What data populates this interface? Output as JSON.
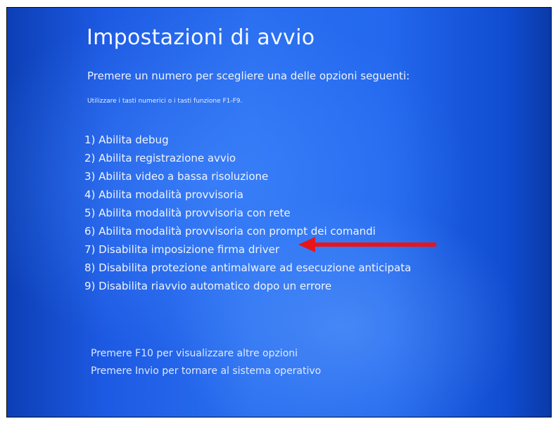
{
  "screen": {
    "title": "Impostazioni di avvio",
    "subtitle": "Premere un numero per scegliere una delle opzioni seguenti:",
    "hint": "Utilizzare i tasti numerici o i tasti funzione F1-F9.",
    "options": [
      {
        "label": "1) Abilita debug"
      },
      {
        "label": "2) Abilita registrazione avvio"
      },
      {
        "label": "3) Abilita video a bassa risoluzione"
      },
      {
        "label": "4) Abilita modalità provvisoria"
      },
      {
        "label": "5) Abilita modalità provvisoria con rete"
      },
      {
        "label": "6) Abilita modalità provvisoria con prompt dei comandi"
      },
      {
        "label": "7) Disabilita imposizione firma driver"
      },
      {
        "label": "8) Disabilita protezione antimalware ad esecuzione anticipata"
      },
      {
        "label": "9) Disabilita riavvio automatico dopo un errore"
      }
    ],
    "footer": {
      "more_options": "Premere F10 per visualizzare altre opzioni",
      "return": "Premere Invio per tornare al sistema operativo"
    }
  },
  "annotation": {
    "icon": "arrow-left-icon",
    "color": "#e8141b"
  },
  "colors": {
    "background": "#2368ee",
    "text": "#f0f5ff"
  }
}
